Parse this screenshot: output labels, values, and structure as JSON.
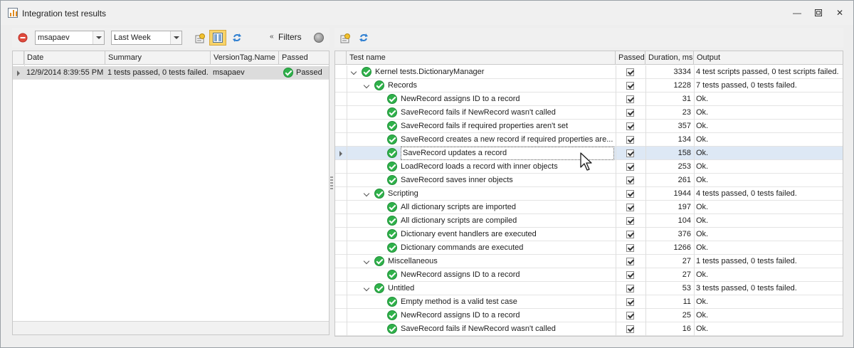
{
  "window": {
    "title": "Integration test results",
    "controls": [
      "minimize-icon",
      "restore-icon",
      "close-icon"
    ]
  },
  "left_toolbar": {
    "user_value": "msapaev",
    "period_value": "Last Week",
    "filters_label": "Filters"
  },
  "left_grid": {
    "columns": [
      "Date",
      "Summary",
      "VersionTag.Name",
      "Passed"
    ],
    "rows": [
      {
        "date": "12/9/2014 8:39:55 PM",
        "summary": "1 tests passed, 0 tests failed.",
        "version": "msapaev",
        "passed": "Passed"
      }
    ]
  },
  "right_grid": {
    "columns": [
      "Test name",
      "Passed",
      "Duration, ms",
      "Output"
    ],
    "rows": [
      {
        "level": 0,
        "expanded": true,
        "name": "Kernel tests.DictionaryManager",
        "duration": "3334",
        "output": "4 test scripts passed, 0 test scripts failed."
      },
      {
        "level": 1,
        "expanded": true,
        "name": "Records",
        "duration": "1228",
        "output": "7 tests passed, 0 tests failed."
      },
      {
        "level": 2,
        "name": "NewRecord assigns ID to a record",
        "duration": "31",
        "output": "Ok."
      },
      {
        "level": 2,
        "name": "SaveRecord fails if NewRecord wasn't called",
        "duration": "23",
        "output": "Ok."
      },
      {
        "level": 2,
        "name": "SaveRecord fails if required properties aren't set",
        "duration": "357",
        "output": "Ok."
      },
      {
        "level": 2,
        "name": "SaveRecord creates a new record if required properties are...",
        "duration": "134",
        "output": "Ok."
      },
      {
        "level": 2,
        "name": "SaveRecord updates a record",
        "duration": "158",
        "output": "Ok.",
        "selected": true
      },
      {
        "level": 2,
        "name": "LoadRecord loads a record with inner objects",
        "duration": "253",
        "output": "Ok."
      },
      {
        "level": 2,
        "name": "SaveRecord saves inner objects",
        "duration": "261",
        "output": "Ok."
      },
      {
        "level": 1,
        "expanded": true,
        "name": "Scripting",
        "duration": "1944",
        "output": "4 tests passed, 0 tests failed."
      },
      {
        "level": 2,
        "name": "All dictionary scripts are imported",
        "duration": "197",
        "output": "Ok."
      },
      {
        "level": 2,
        "name": "All dictionary scripts are compiled",
        "duration": "104",
        "output": "Ok."
      },
      {
        "level": 2,
        "name": "Dictionary event handlers are executed",
        "duration": "376",
        "output": "Ok."
      },
      {
        "level": 2,
        "name": "Dictionary commands are executed",
        "duration": "1266",
        "output": "Ok."
      },
      {
        "level": 1,
        "expanded": true,
        "name": "Miscellaneous",
        "duration": "27",
        "output": "1 tests passed, 0 tests failed."
      },
      {
        "level": 2,
        "name": "NewRecord assigns ID to a record",
        "duration": "27",
        "output": "Ok."
      },
      {
        "level": 1,
        "expanded": true,
        "name": "Untitled",
        "duration": "53",
        "output": "3 tests passed, 0 tests failed."
      },
      {
        "level": 2,
        "name": "Empty method is a valid test case",
        "duration": "11",
        "output": "Ok."
      },
      {
        "level": 2,
        "name": "NewRecord assigns ID to a record",
        "duration": "25",
        "output": "Ok."
      },
      {
        "level": 2,
        "name": "SaveRecord fails if NewRecord wasn't called",
        "duration": "16",
        "output": "Ok."
      }
    ]
  },
  "colors": {
    "pass_green": "#2fb14a",
    "selection": "#dde8f5",
    "active_toggle": "#f7d36b"
  }
}
